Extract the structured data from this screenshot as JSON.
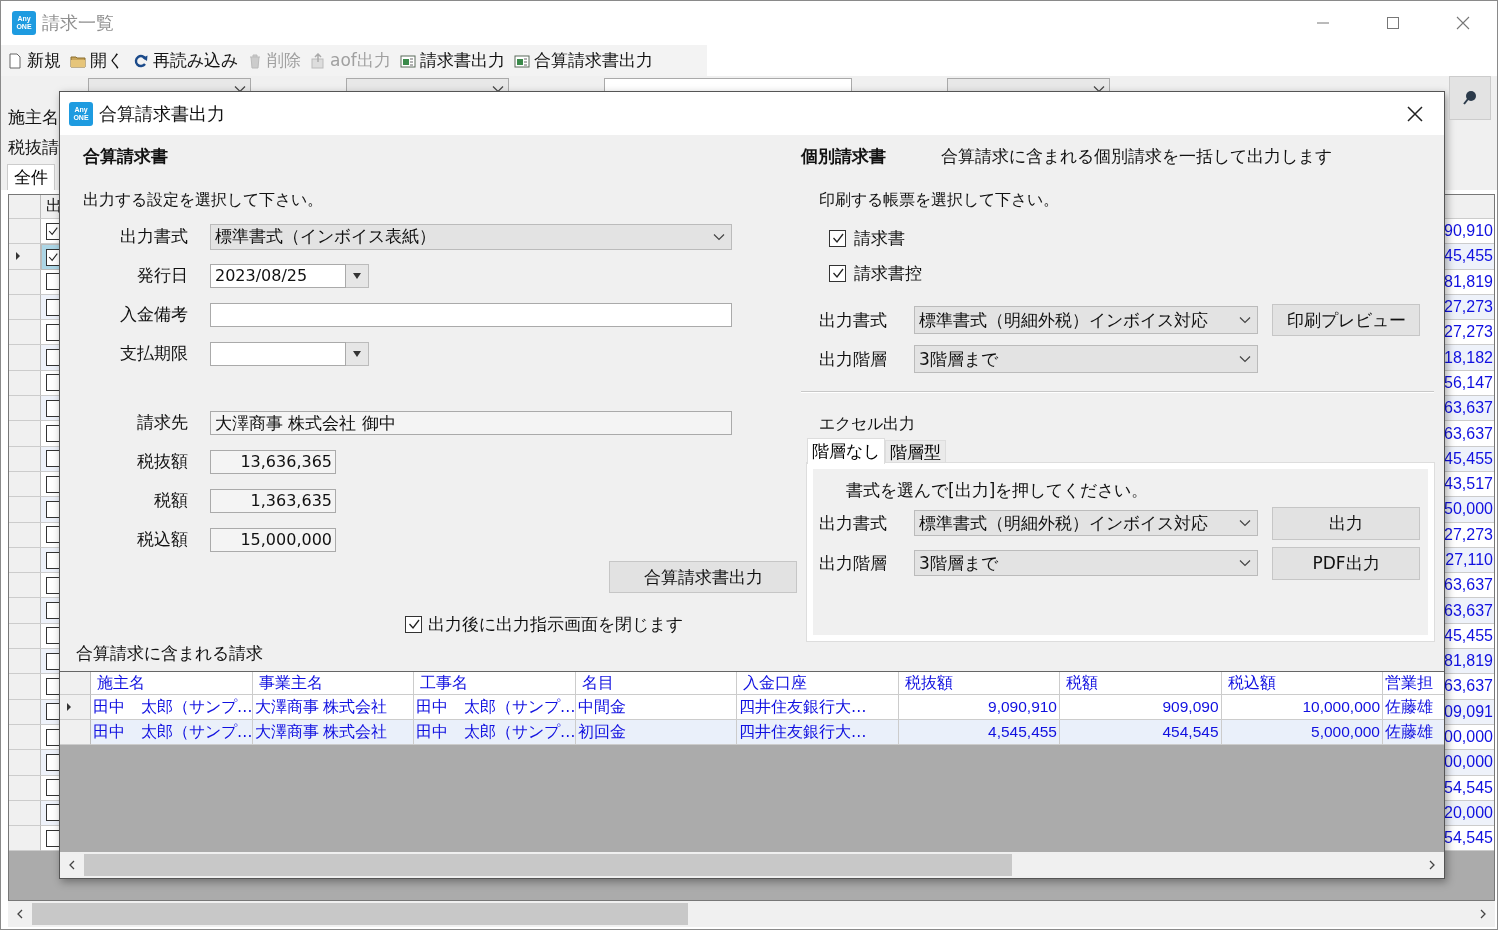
{
  "window": {
    "title": "請求一覧",
    "logo": [
      "Any",
      "ONE"
    ]
  },
  "toolbar": [
    {
      "label": "新規",
      "disabled": false
    },
    {
      "label": "開く",
      "disabled": false
    },
    {
      "label": "再読み込み",
      "disabled": false
    },
    {
      "label": "削除",
      "disabled": true
    },
    {
      "label": "aof出力",
      "disabled": true
    },
    {
      "label": "請求書出力",
      "disabled": false
    },
    {
      "label": "合算請求書出力",
      "disabled": false
    }
  ],
  "filters": [
    {
      "kind": "combo"
    },
    {
      "kind": "combo"
    },
    {
      "kind": "text"
    },
    {
      "kind": "combo"
    }
  ],
  "side_labels": [
    "施主名",
    "税抜請"
  ],
  "view_tabs": [
    {
      "label": "全件",
      "selected": true
    }
  ],
  "grid": {
    "column_2_header": "出",
    "rows": [
      {
        "selected": false,
        "checked": true,
        "amount": "90,910"
      },
      {
        "selected": true,
        "checked": true,
        "amount": "45,455"
      },
      {
        "selected": false,
        "checked": false,
        "amount": "81,819"
      },
      {
        "selected": false,
        "checked": false,
        "amount": "27,273"
      },
      {
        "selected": false,
        "checked": false,
        "amount": "27,273"
      },
      {
        "selected": false,
        "checked": false,
        "amount": "18,182"
      },
      {
        "selected": false,
        "checked": false,
        "amount": "56,147"
      },
      {
        "selected": false,
        "checked": false,
        "amount": "63,637"
      },
      {
        "selected": false,
        "checked": false,
        "amount": "63,637"
      },
      {
        "selected": false,
        "checked": false,
        "amount": "45,455"
      },
      {
        "selected": false,
        "checked": false,
        "amount": "43,517"
      },
      {
        "selected": false,
        "checked": false,
        "amount": "50,000"
      },
      {
        "selected": false,
        "checked": false,
        "amount": "27,273"
      },
      {
        "selected": false,
        "checked": false,
        "amount": "27,110"
      },
      {
        "selected": false,
        "checked": false,
        "amount": "63,637"
      },
      {
        "selected": false,
        "checked": false,
        "amount": "63,637"
      },
      {
        "selected": false,
        "checked": false,
        "amount": "45,455"
      },
      {
        "selected": false,
        "checked": false,
        "amount": "81,819"
      },
      {
        "selected": false,
        "checked": false,
        "amount": "63,637"
      },
      {
        "selected": false,
        "checked": false,
        "amount": "09,091"
      },
      {
        "selected": false,
        "checked": false,
        "amount": "00,000"
      },
      {
        "selected": false,
        "checked": false,
        "amount": "00,000"
      },
      {
        "selected": false,
        "checked": false,
        "amount": "54,545"
      },
      {
        "selected": false,
        "checked": false,
        "amount": "20,000"
      },
      {
        "selected": false,
        "checked": false,
        "amount": "54,545"
      }
    ]
  },
  "dialog": {
    "title": "合算請求書出力",
    "logo": [
      "Any",
      "ONE"
    ],
    "combined": {
      "heading": "合算請求書",
      "instruction": "出力する設定を選択して下さい。",
      "settings": [
        {
          "label": "出力書式",
          "kind": "select",
          "value": "標準書式（インボイス表紙）"
        },
        {
          "label": "発行日",
          "kind": "date",
          "value": "2023/08/25"
        },
        {
          "label": "入金備考",
          "kind": "text"
        },
        {
          "label": "支払期限",
          "kind": "date"
        }
      ],
      "billing": [
        {
          "label": "請求先",
          "kind": "text",
          "value": "大澤商事 株式会社 御中"
        },
        {
          "label": "税抜額",
          "kind": "amount",
          "value": "13,636,365"
        },
        {
          "label": "税額",
          "kind": "amount",
          "value": "1,363,635"
        },
        {
          "label": "税込額",
          "kind": "amount",
          "value": "15,000,000"
        }
      ],
      "button": "合算請求書出力",
      "close_after": {
        "label": "出力後に出力指示画面を閉じます",
        "checked": true
      }
    },
    "individual": {
      "heading": "個別請求書",
      "description": "合算請求に含まれる個別請求を一括して出力します",
      "instruction": "印刷する帳票を選択して下さい。",
      "documents": [
        {
          "label": "請求書",
          "checked": true
        },
        {
          "label": "請求書控",
          "checked": true
        }
      ],
      "format": {
        "label": "出力書式",
        "value": "標準書式（明細外税）インボイス対応"
      },
      "level": {
        "label": "出力階層",
        "value": "3階層まで"
      },
      "preview_button": "印刷プレビュー",
      "excel": {
        "heading": "エクセル出力",
        "tabs": [
          {
            "label": "階層なし",
            "selected": true
          },
          {
            "label": "階層型",
            "selected": false
          }
        ],
        "instruction": "書式を選んで[出力]を押してください。",
        "format": {
          "label": "出力書式",
          "value": "標準書式（明細外税）インボイス対応"
        },
        "level": {
          "label": "出力階層",
          "value": "3階層まで"
        },
        "buttons": [
          "出力",
          "PDF出力"
        ]
      }
    },
    "included": {
      "heading": "合算請求に含まれる請求",
      "columns": [
        {
          "label": "施主名",
          "kind": "text"
        },
        {
          "label": "事業主名",
          "kind": "text"
        },
        {
          "label": "工事名",
          "kind": "text"
        },
        {
          "label": "名目",
          "kind": "text"
        },
        {
          "label": "入金口座",
          "kind": "text"
        },
        {
          "label": "税抜額",
          "kind": "number"
        },
        {
          "label": "税額",
          "kind": "number"
        },
        {
          "label": "税込額",
          "kind": "number"
        },
        {
          "label": "営業担",
          "kind": "text"
        }
      ],
      "rows": [
        {
          "selected": true,
          "cells": [
            "田中　太郎（サンプ…",
            "大澤商事 株式会社",
            "田中　太郎（サンプ…",
            "中間金",
            "四井住友銀行大…",
            "9,090,910",
            "909,090",
            "10,000,000",
            "佐藤雄"
          ]
        },
        {
          "selected": false,
          "cells": [
            "田中　太郎（サンプ…",
            "大澤商事 株式会社",
            "田中　太郎（サンプ…",
            "初回金",
            "四井住友銀行大…",
            "4,545,455",
            "454,545",
            "5,000,000",
            "佐藤雄"
          ]
        }
      ]
    }
  }
}
